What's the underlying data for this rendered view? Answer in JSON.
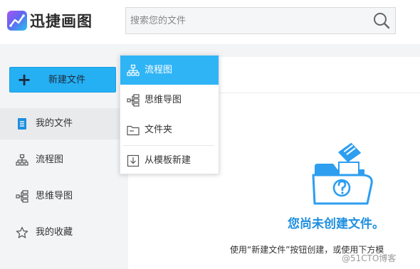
{
  "app": {
    "logo_text": "迅捷画图",
    "logo_icon": "chart-line-icon"
  },
  "search": {
    "placeholder": "搜索您的文件",
    "icon": "search-icon"
  },
  "sidebar": {
    "new_button": {
      "icon": "plus-icon",
      "label": "新建文件"
    },
    "items": [
      {
        "label": "我的文件",
        "icon": "document-icon",
        "active": true
      },
      {
        "label": "流程图",
        "icon": "flowchart-icon",
        "active": false
      },
      {
        "label": "思维导图",
        "icon": "mindmap-icon",
        "active": false
      },
      {
        "label": "我的收藏",
        "icon": "star-icon",
        "active": false
      }
    ]
  },
  "new_menu": {
    "items": [
      {
        "label": "流程图",
        "icon": "flowchart-icon",
        "active": true
      },
      {
        "label": "思维导图",
        "icon": "mindmap-icon",
        "active": false
      },
      {
        "label": "文件夹",
        "icon": "folder-icon",
        "active": false
      },
      {
        "label": "从模板新建",
        "icon": "template-icon",
        "active": false
      }
    ]
  },
  "empty_state": {
    "title": "您尚未创建文件。",
    "hint": "使用“新建文件”按钮创建，或使用下方模",
    "icon": "folder-question-icon"
  },
  "watermark": "@51CTO博客",
  "colors": {
    "accent": "#25b0f4",
    "menu_active": "#2fb4f5",
    "empty_title": "#1e8fe0",
    "sidebar_bg": "#f3f4f6"
  }
}
